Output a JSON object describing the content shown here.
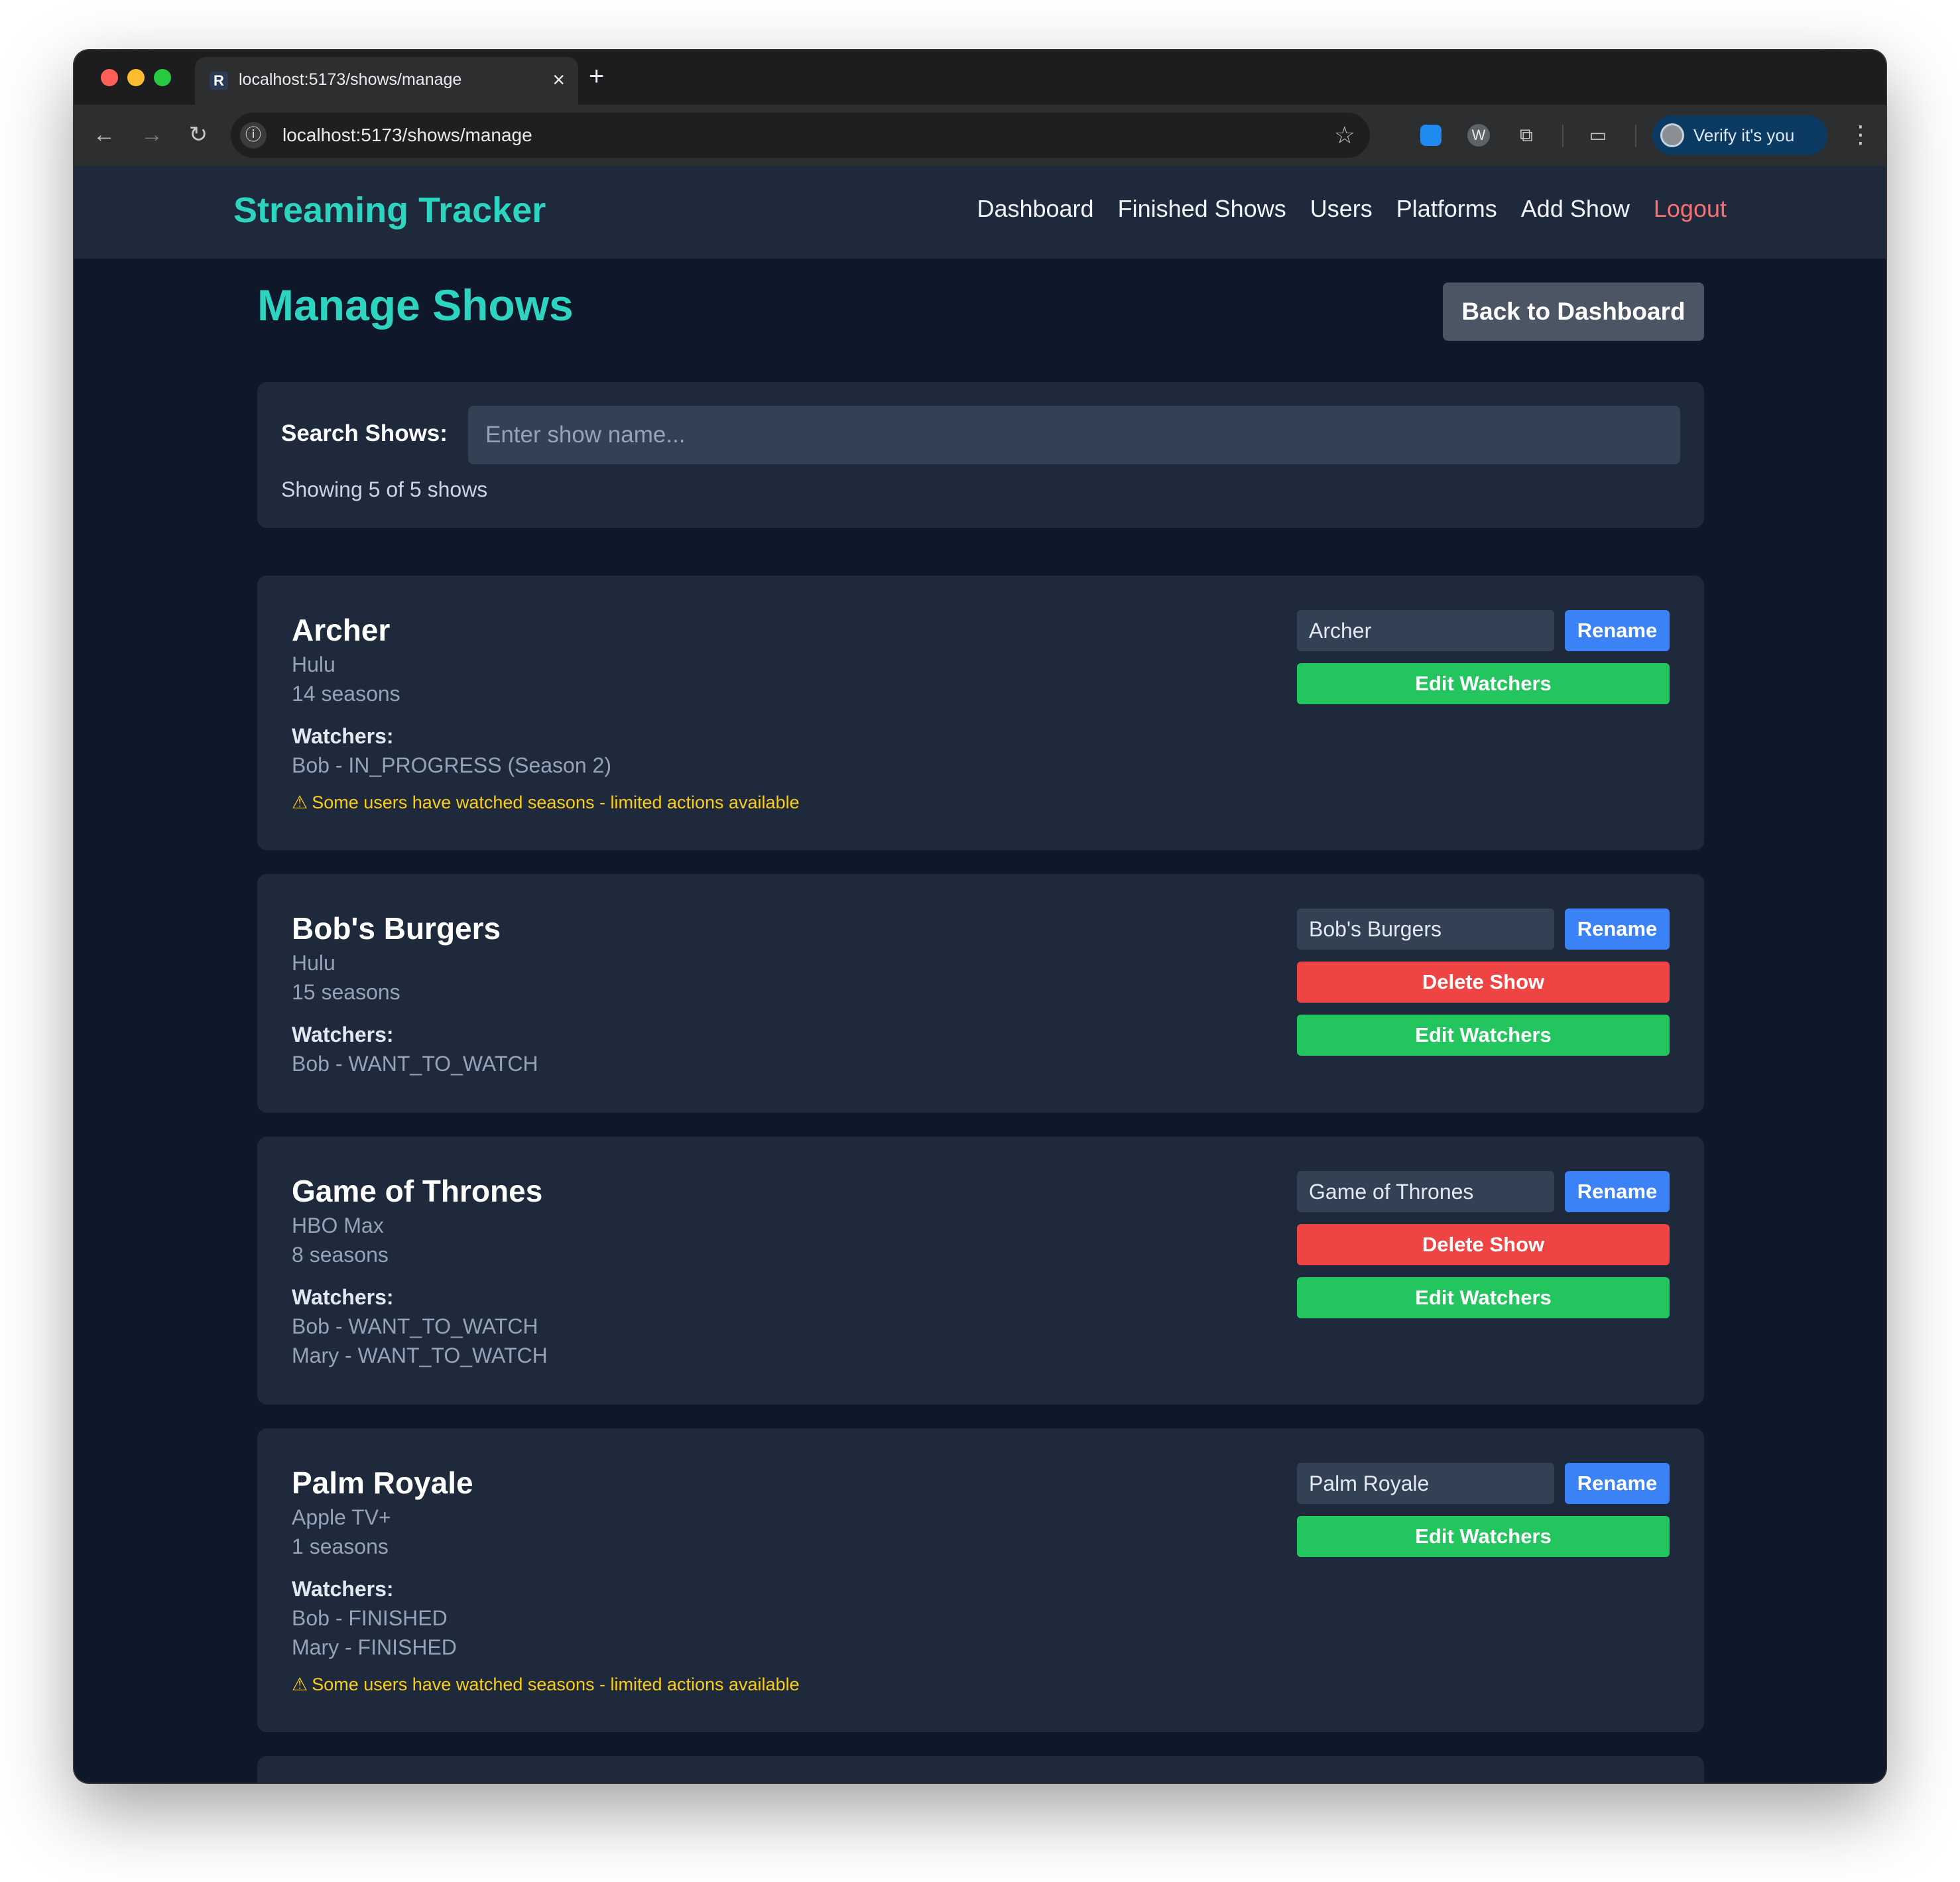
{
  "browser": {
    "tab_title": "localhost:5173/shows/manage",
    "tab_favicon_letter": "R",
    "url": "localhost:5173/shows/manage",
    "profile_label": "Verify it's you"
  },
  "nav": {
    "brand": "Streaming Tracker",
    "links": [
      "Dashboard",
      "Finished Shows",
      "Users",
      "Platforms",
      "Add Show",
      "Logout"
    ]
  },
  "page": {
    "title": "Manage Shows",
    "back_button": "Back to Dashboard"
  },
  "search": {
    "label": "Search Shows:",
    "placeholder": "Enter show name...",
    "count_text": "Showing 5 of 5 shows"
  },
  "labels": {
    "watchers": "Watchers:",
    "rename": "Rename",
    "delete": "Delete Show",
    "edit_watchers": "Edit Watchers",
    "warning": "Some users have watched seasons - limited actions available"
  },
  "shows": [
    {
      "name": "Archer",
      "platform": "Hulu",
      "seasons": "14 seasons",
      "watchers": [
        "Bob - IN_PROGRESS (Season 2)"
      ],
      "rename_value": "Archer",
      "can_delete": false,
      "warning": true
    },
    {
      "name": "Bob's Burgers",
      "platform": "Hulu",
      "seasons": "15 seasons",
      "watchers": [
        "Bob - WANT_TO_WATCH"
      ],
      "rename_value": "Bob's Burgers",
      "can_delete": true,
      "warning": false
    },
    {
      "name": "Game of Thrones",
      "platform": "HBO Max",
      "seasons": "8 seasons",
      "watchers": [
        "Bob - WANT_TO_WATCH",
        "Mary - WANT_TO_WATCH"
      ],
      "rename_value": "Game of Thrones",
      "can_delete": true,
      "warning": false
    },
    {
      "name": "Palm Royale",
      "platform": "Apple TV+",
      "seasons": "1 seasons",
      "watchers": [
        "Bob - FINISHED",
        "Mary - FINISHED"
      ],
      "rename_value": "Palm Royale",
      "can_delete": false,
      "warning": true
    }
  ],
  "colors": {
    "accent": "#2dd4bf",
    "page_bg": "#0f172a",
    "card_bg": "#1e293b",
    "rename": "#3b82f6",
    "delete": "#ef4444",
    "edit_watchers": "#22c55e",
    "warning": "#facc15",
    "logout": "#f87171"
  }
}
